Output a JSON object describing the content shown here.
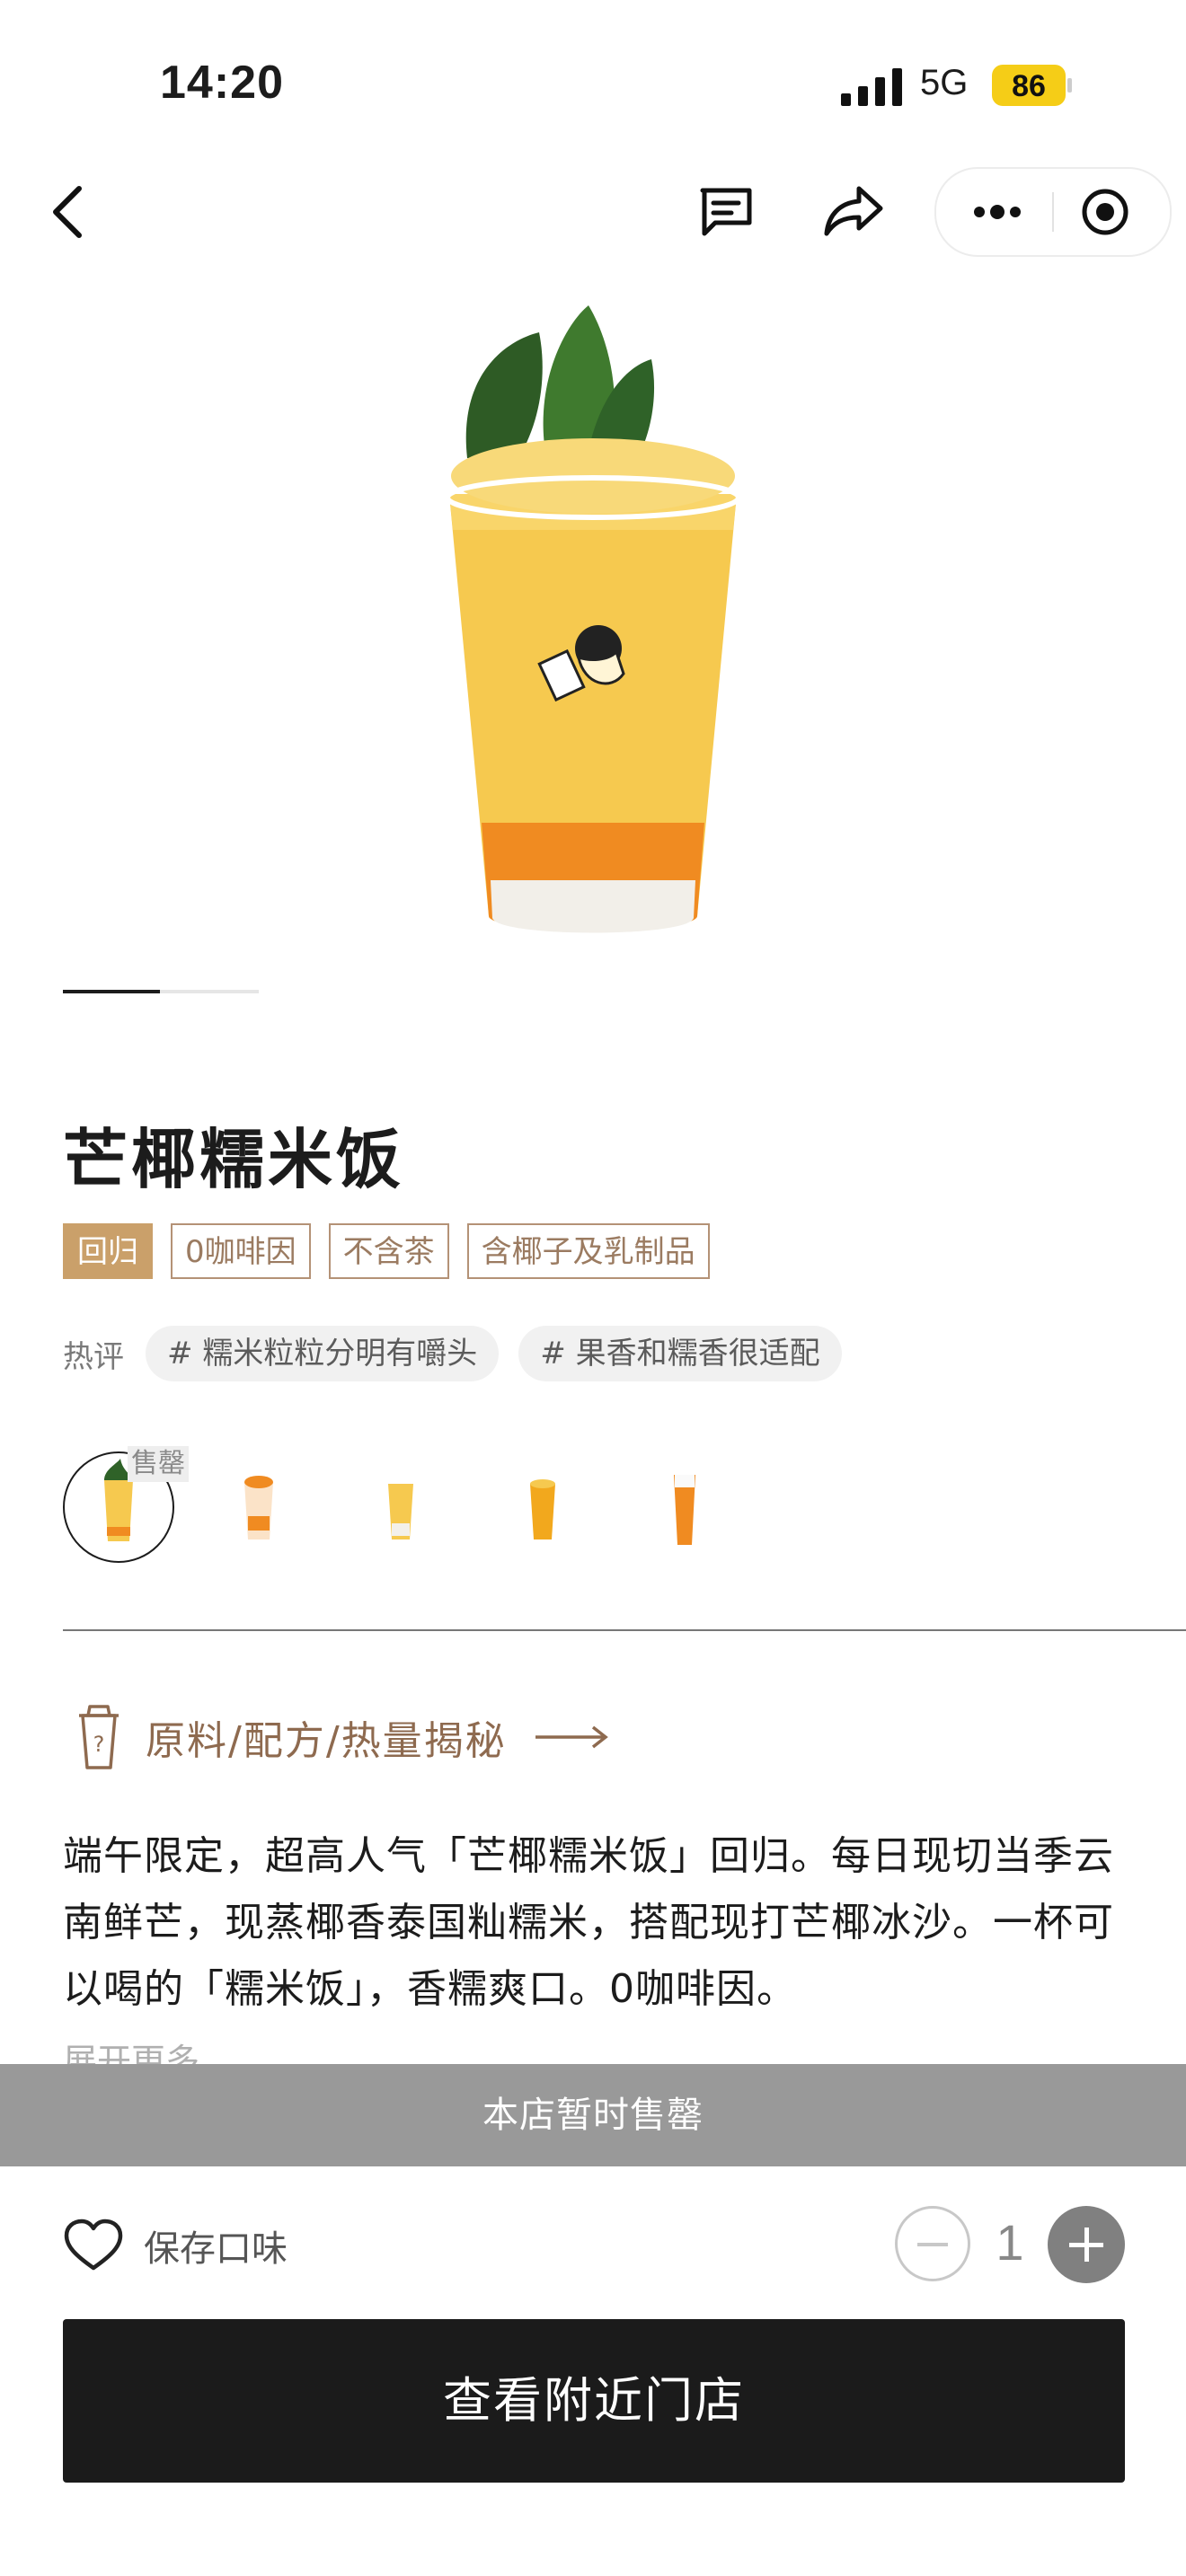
{
  "status_bar": {
    "time": "14:20",
    "network": "5G",
    "battery": "86"
  },
  "product": {
    "name": "芒椰糯米饭",
    "tags": [
      {
        "label": "回归",
        "style": "filled"
      },
      {
        "label": "0咖啡因",
        "style": "outline"
      },
      {
        "label": "不含茶",
        "style": "outline"
      },
      {
        "label": "含椰子及乳制品",
        "style": "outline"
      }
    ],
    "review_label": "热评",
    "reviews": [
      "# 糯米粒粒分明有嚼头",
      "# 果香和糯香很适配"
    ],
    "variants_soldout_badge": "售罄",
    "recipe_link": "原料/配方/热量揭秘",
    "description": "端午限定，超高人气「芒椰糯米饭」回归。每日现切当季云南鲜芒，现蒸椰香泰国籼糯米，搭配现打芒椰冰沙。一杯可以喝的「糯米饭」，香糯爽口。0咖啡因。",
    "expand_label": "展开更多 ⌄"
  },
  "sold_out_bar": "本店暂时售罄",
  "bottom_bar": {
    "save_label": "保存口味",
    "quantity": "1",
    "cta_label": "查看附近门店"
  },
  "colors": {
    "accent": "#caa06a",
    "brown_text": "#8e6a4f",
    "cta_bg": "#1b1b1b",
    "soldout_bar": "#999999"
  }
}
